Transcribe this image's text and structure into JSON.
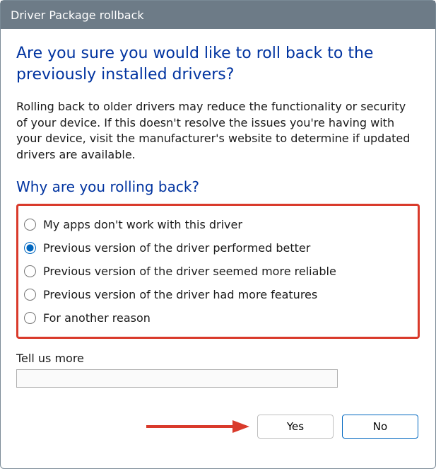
{
  "titlebar": "Driver Package rollback",
  "heading": "Are you sure you would like to roll back to the previously installed drivers?",
  "description": "Rolling back to older drivers may reduce the functionality or security of your device.  If this doesn't resolve the issues you're having with your device, visit the manufacturer's website to determine if updated drivers are available.",
  "subheading": "Why are you rolling back?",
  "reasons": [
    {
      "label": "My apps don't work with this driver",
      "selected": false
    },
    {
      "label": "Previous version of the driver performed better",
      "selected": true
    },
    {
      "label": "Previous version of the driver seemed more reliable",
      "selected": false
    },
    {
      "label": "Previous version of the driver had more features",
      "selected": false
    },
    {
      "label": "For another reason",
      "selected": false
    }
  ],
  "tellmore_label": "Tell us more",
  "tellmore_value": "",
  "buttons": {
    "yes": "Yes",
    "no": "No"
  },
  "annotation": {
    "highlight_box_color": "#d93a2b",
    "arrow_color": "#d93a2b"
  }
}
